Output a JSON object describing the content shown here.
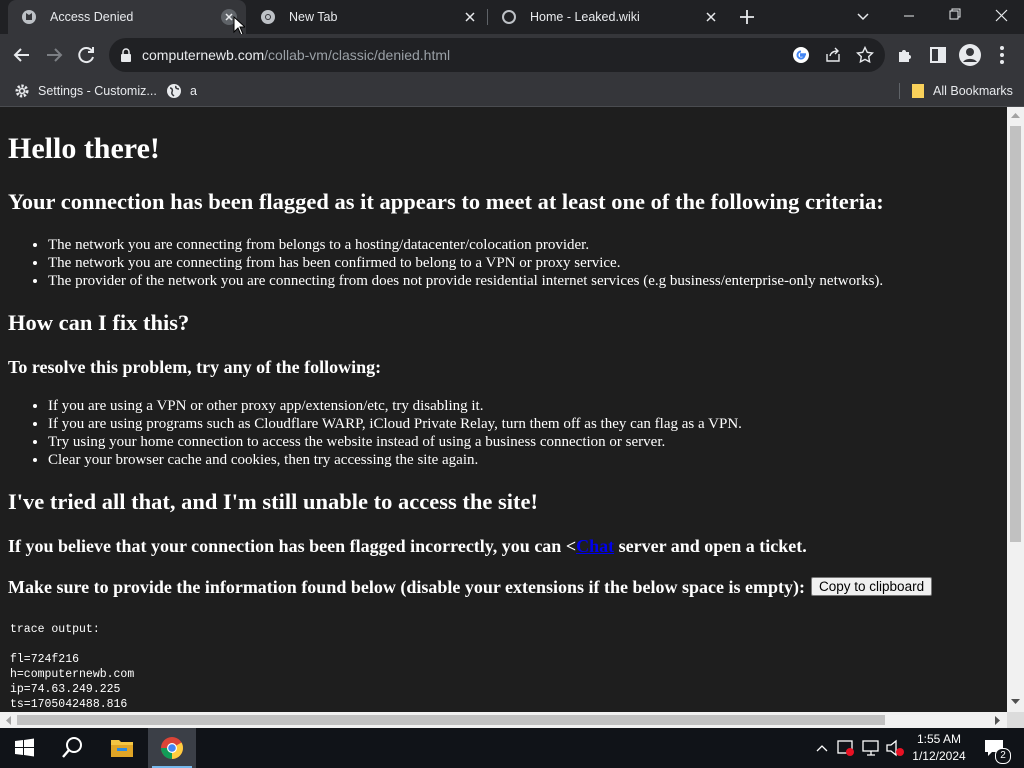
{
  "tabs": [
    {
      "title": "Access Denied",
      "active": true
    },
    {
      "title": "New Tab",
      "active": false
    },
    {
      "title": "Home - Leaked.wiki",
      "active": false
    }
  ],
  "address_bar": {
    "host": "computernewb.com",
    "path": "/collab-vm/classic/denied.html"
  },
  "bookmarks": {
    "items": [
      {
        "label": "Settings - Customiz...",
        "icon": "gear-icon"
      },
      {
        "label": "a",
        "icon": "globe-icon"
      }
    ],
    "all_bookmarks_label": "All Bookmarks"
  },
  "page": {
    "heading": "Hello there!",
    "flag_heading": "Your connection has been flagged as it appears to meet at least one of the following criteria:",
    "criteria": [
      "The network you are connecting from belongs to a hosting/datacenter/colocation provider.",
      "The network you are connecting from has been confirmed to belong to a VPN or proxy service.",
      "The provider of the network you are connecting from does not provide residential internet services (e.g business/enterprise-only networks)."
    ],
    "fix_heading": "How can I fix this?",
    "resolve_heading": "To resolve this problem, try any of the following:",
    "fixes": [
      "If you are using a VPN or other proxy app/extension/etc, try disabling it.",
      "If you are using programs such as Cloudflare WARP, iCloud Private Relay, turn them off as they can flag as a VPN.",
      "Try using your home connection to access the website instead of using a business connection or server.",
      "Clear your browser cache and cookies, then try accessing the site again."
    ],
    "still_heading": "I've tried all that, and I'm still unable to access the site!",
    "incorrect_before": "If you believe that your connection has been flagged incorrectly, you can <",
    "incorrect_link": "Chat",
    "incorrect_after": " server and open a ticket.",
    "provide_text": "Make sure to provide the information found below (disable your extensions if the below space is empty):",
    "copy_button": "Copy to clipboard",
    "trace_output": "trace output:\n\nfl=724f216\nh=computernewb.com\nip=74.63.249.225\nts=1705042488.816"
  },
  "taskbar": {
    "time": "1:55 AM",
    "date": "1/12/2024",
    "notification_count": "2"
  },
  "colors": {
    "page_background": "#1e1e1e",
    "chrome_dark": "#202124",
    "chrome_toolbar": "#35363a",
    "link": "#0000ee"
  }
}
